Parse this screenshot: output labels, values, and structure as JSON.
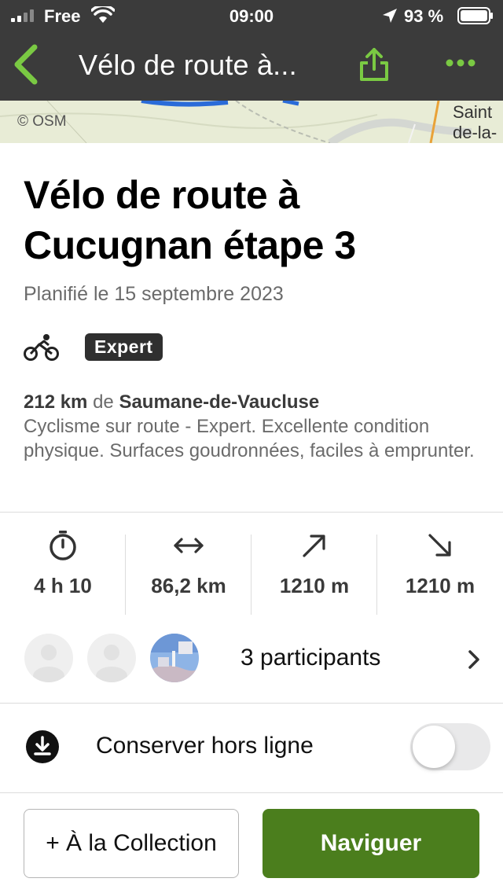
{
  "status_bar": {
    "carrier": "Free",
    "time": "09:00",
    "battery_percent": "93 %"
  },
  "nav": {
    "title": "Vélo de route à...",
    "accent_color": "#7ac943"
  },
  "map": {
    "attribution": "© OSM",
    "place_label": "Saint de-la-"
  },
  "tour": {
    "title": "Vélo de route à Cucugnan étape 3",
    "planned": "Planifié le 15 septembre 2023",
    "sport_icon": "road-bike-icon",
    "difficulty": "Expert",
    "distance_total": "212 km",
    "from_word": "de",
    "start_place": "Saumane-de-Vaucluse",
    "description": "Cyclisme sur route - Expert. Excellente condition physique. Surfaces goudronnées, faciles à emprunter."
  },
  "stats": [
    {
      "icon": "stopwatch-icon",
      "value": "4 h 10"
    },
    {
      "icon": "distance-arrows-icon",
      "value": "86,2 km"
    },
    {
      "icon": "uphill-arrow-icon",
      "value": "1210 m"
    },
    {
      "icon": "downhill-arrow-icon",
      "value": "1210 m"
    }
  ],
  "participants": {
    "label": "3 participants"
  },
  "offline": {
    "label": "Conserver hors ligne",
    "enabled": false
  },
  "actions": {
    "collection_label": "+ À la Collection",
    "navigate_label": "Naviguer",
    "navigate_color": "#4b7e1d"
  }
}
